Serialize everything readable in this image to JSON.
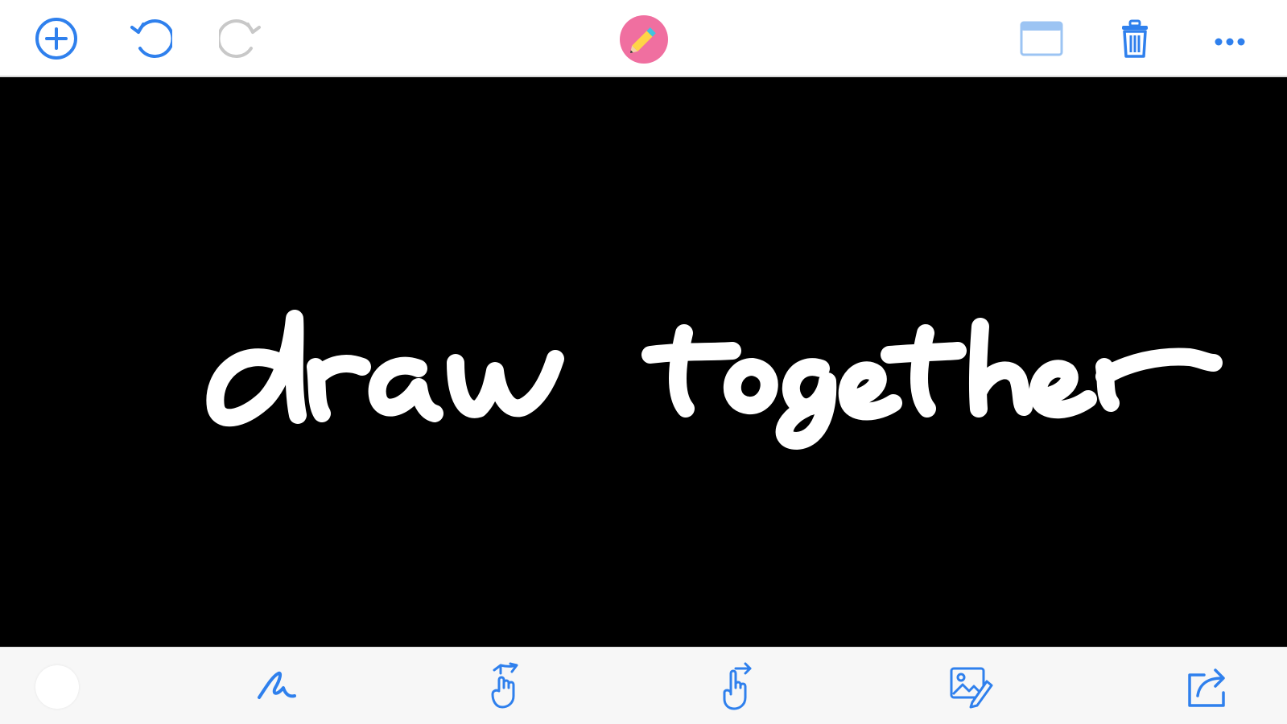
{
  "colors": {
    "accent": "#2f80ed",
    "accent_disabled": "#c8c8c8",
    "canvas_bg": "#000000",
    "ink": "#ffffff",
    "avatar_bg": "#f06fa0",
    "toolbar_bg": "#ffffff",
    "bottom_bar_bg": "#f7f7f7"
  },
  "top_toolbar": {
    "left_icons": [
      "add-circle-icon",
      "undo-icon",
      "redo-icon"
    ],
    "center_icon": "pencil-avatar-icon",
    "right_icons": [
      "window-icon",
      "trash-icon",
      "more-icon"
    ],
    "redo_enabled": false
  },
  "canvas": {
    "drawing_text": "draw together",
    "ink_color": "#ffffff"
  },
  "bottom_toolbar": {
    "current_color": "#ffffff",
    "tools": [
      "brush-icon",
      "move-gesture-icon",
      "pointer-gesture-icon",
      "image-edit-icon",
      "share-icon"
    ]
  }
}
